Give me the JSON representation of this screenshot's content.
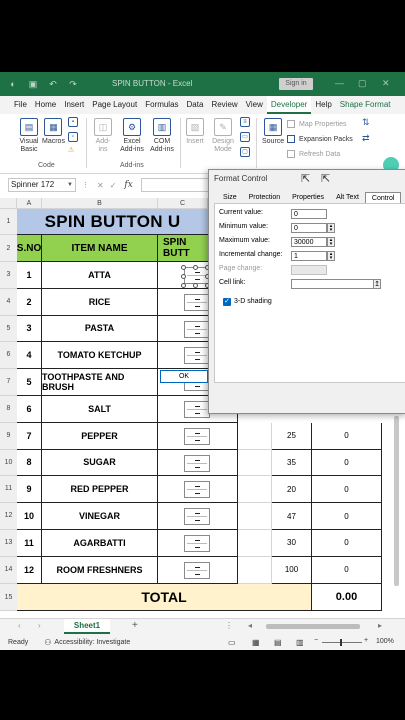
{
  "titlebar": {
    "title": "SPIN BUTTON  -  Excel",
    "signin": "Sign in"
  },
  "ribbon_tabs": [
    "File",
    "Home",
    "Insert",
    "Page Layout",
    "Formulas",
    "Data",
    "Review",
    "View",
    "Developer",
    "Help",
    "Shape Format"
  ],
  "ribbon": {
    "code": {
      "visual_basic": "Visual Basic",
      "macros": "Macros",
      "group": "Code"
    },
    "addins": {
      "addins": "Add-ins",
      "excel_addins": "Excel Add-ins",
      "com_addins": "COM Add-ins",
      "group": "Add-ins"
    },
    "controls": {
      "insert": "Insert",
      "design_mode": "Design Mode"
    },
    "xml": {
      "source": "Source",
      "map_properties": "Map Properties",
      "expansion_packs": "Expansion Packs",
      "refresh_data": "Refresh Data"
    }
  },
  "formula_bar": {
    "name_box": "Spinner 172",
    "fx": "fx"
  },
  "columns": [
    "A",
    "B",
    "C"
  ],
  "sheet": {
    "title": "SPIN BUTTON U",
    "headers": {
      "sno": "S.NO",
      "item": "ITEM NAME",
      "spin": "SPIN BUTT"
    },
    "rows": [
      {
        "sno": "1",
        "item": "ATTA",
        "qty": "",
        "total": ""
      },
      {
        "sno": "2",
        "item": "RICE",
        "qty": "",
        "total": ""
      },
      {
        "sno": "3",
        "item": "PASTA",
        "qty": "",
        "total": ""
      },
      {
        "sno": "4",
        "item": "TOMATO KETCHUP",
        "qty": "",
        "total": ""
      },
      {
        "sno": "5",
        "item": "TOOTHPASTE AND BRUSH",
        "qty": "",
        "total": ""
      },
      {
        "sno": "6",
        "item": "SALT",
        "qty": "",
        "total": ""
      },
      {
        "sno": "7",
        "item": "PEPPER",
        "qty": "25",
        "total": "0"
      },
      {
        "sno": "8",
        "item": "SUGAR",
        "qty": "35",
        "total": "0"
      },
      {
        "sno": "9",
        "item": "RED PEPPER",
        "qty": "20",
        "total": "0"
      },
      {
        "sno": "10",
        "item": "VINEGAR",
        "qty": "47",
        "total": "0"
      },
      {
        "sno": "11",
        "item": "AGARBATTI",
        "qty": "30",
        "total": "0"
      },
      {
        "sno": "12",
        "item": "ROOM FRESHNERS",
        "qty": "100",
        "total": "0"
      }
    ],
    "row_numbers": [
      "1",
      "2",
      "3",
      "4",
      "5",
      "6",
      "7",
      "8",
      "9",
      "10",
      "11",
      "12",
      "13",
      "14",
      "15"
    ],
    "total_label": "TOTAL",
    "total_value": "0.00"
  },
  "sheet_tab": "Sheet1",
  "status": {
    "ready": "Ready",
    "accessibility": "Accessibility: Investigate",
    "zoom": "100%"
  },
  "dialog": {
    "title": "Format Control",
    "tabs": [
      "Size",
      "Protection",
      "Properties",
      "Alt Text",
      "Control"
    ],
    "active_tab": "Control",
    "fields": {
      "current_value_label": "Current value:",
      "current_value": "0",
      "minimum_label": "Minimum value:",
      "minimum": "0",
      "maximum_label": "Maximum value:",
      "maximum": "30000",
      "increment_label": "Incremental change:",
      "increment": "1",
      "page_change_label": "Page change:",
      "cell_link_label": "Cell link:",
      "shading_label": "3-D shading"
    },
    "ok": "OK"
  },
  "colors": {
    "excel_green": "#1e7145",
    "title_fill": "#b4c7e7",
    "header_fill": "#92d050",
    "total_fill": "#fff2cc"
  }
}
